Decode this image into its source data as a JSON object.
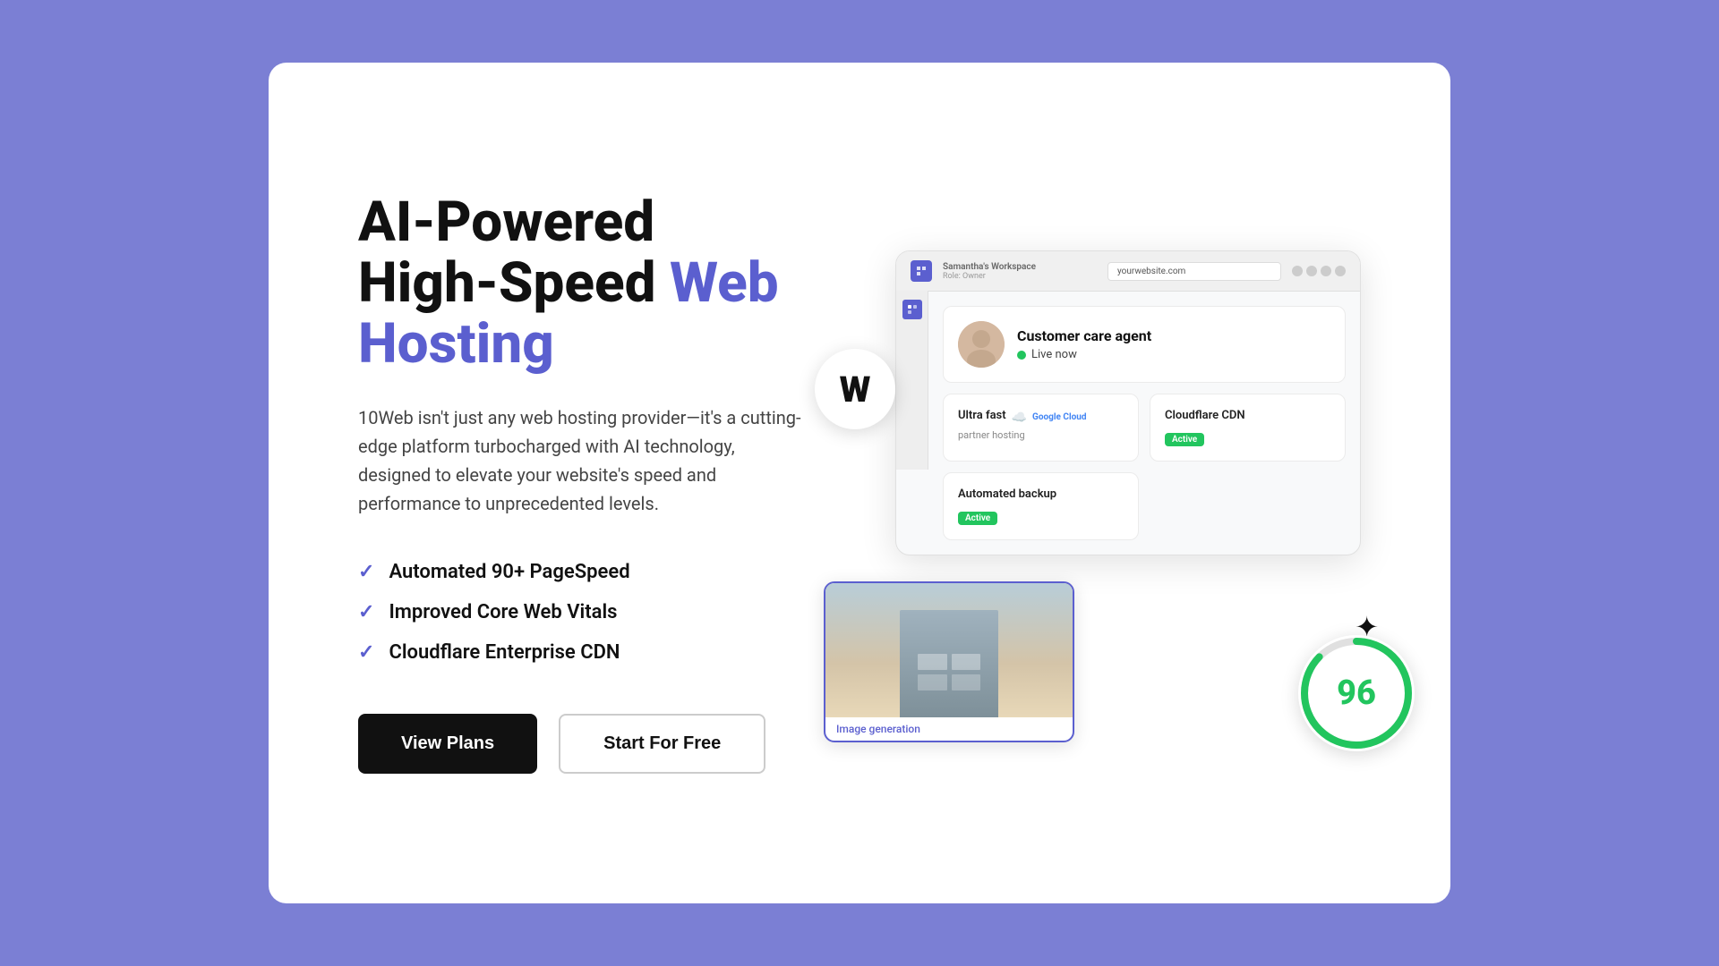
{
  "page": {
    "background_color": "#7b7fd4",
    "card_background": "#ffffff"
  },
  "hero": {
    "headline_part1": "AI-Powered High-Speed ",
    "headline_accent": "Web Hosting",
    "description": "10Web isn't just any web hosting provider—it's a cutting-edge platform turbocharged with AI technology, designed to elevate your website's speed and performance to unprecedented levels.",
    "features": [
      {
        "label": "Automated 90+ PageSpeed"
      },
      {
        "label": "Improved Core Web Vitals"
      },
      {
        "label": "Cloudflare Enterprise CDN"
      }
    ],
    "button_primary": "View Plans",
    "button_secondary": "Start For Free"
  },
  "dashboard": {
    "workspace": "Samantha's Workspace",
    "role": "Role: Owner",
    "url": "yourwebsite.com",
    "cards": {
      "google_cloud": {
        "title": "Ultra fast",
        "provider": "Google Cloud",
        "subtitle": "partner hosting"
      },
      "cloudflare": {
        "title": "Cloudflare CDN",
        "status": "Active"
      },
      "backup": {
        "title": "Automated backup",
        "status": "Active"
      },
      "agent": {
        "name": "Customer care agent",
        "live_label": "Live now"
      }
    },
    "image_gen_label": "Image generation",
    "score": "96"
  }
}
